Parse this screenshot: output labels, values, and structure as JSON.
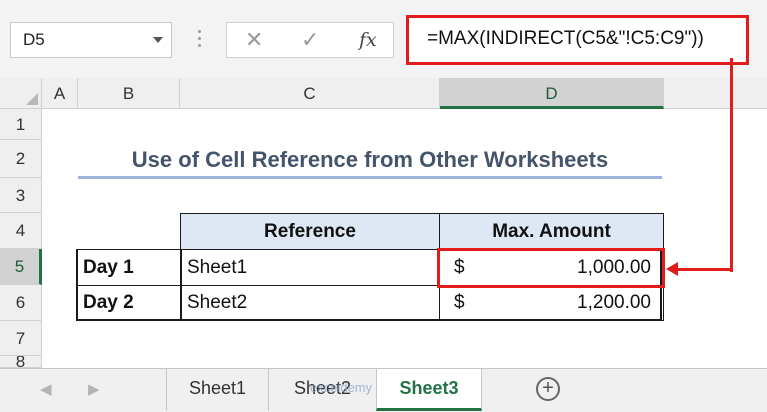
{
  "formula_bar": {
    "name_box": "D5",
    "cancel_icon": "✕",
    "enter_icon": "✓",
    "fx_label": "fx",
    "formula": "=MAX(INDIRECT(C5&\"!C5:C9\"))"
  },
  "columns": [
    "A",
    "B",
    "C",
    "D"
  ],
  "rows": [
    "1",
    "2",
    "3",
    "4",
    "5",
    "6",
    "7",
    "8"
  ],
  "selected_cell": "D5",
  "title": "Use of Cell Reference from Other Worksheets",
  "table": {
    "headers": [
      "Reference",
      "Max. Amount"
    ],
    "rows": [
      {
        "label": "Day 1",
        "reference": "Sheet1",
        "currency": "$",
        "amount": "1,000.00"
      },
      {
        "label": "Day 2",
        "reference": "Sheet2",
        "currency": "$",
        "amount": "1,200.00"
      }
    ]
  },
  "sheet_tabs": {
    "tabs": [
      "Sheet1",
      "Sheet2",
      "Sheet3"
    ],
    "active": "Sheet3",
    "add_label": "+"
  },
  "watermark": "exceldemy",
  "colors": {
    "highlight_red": "#e21b1b",
    "excel_green": "#217346",
    "header_fill": "#dde8f4",
    "title_text": "#44546a"
  }
}
